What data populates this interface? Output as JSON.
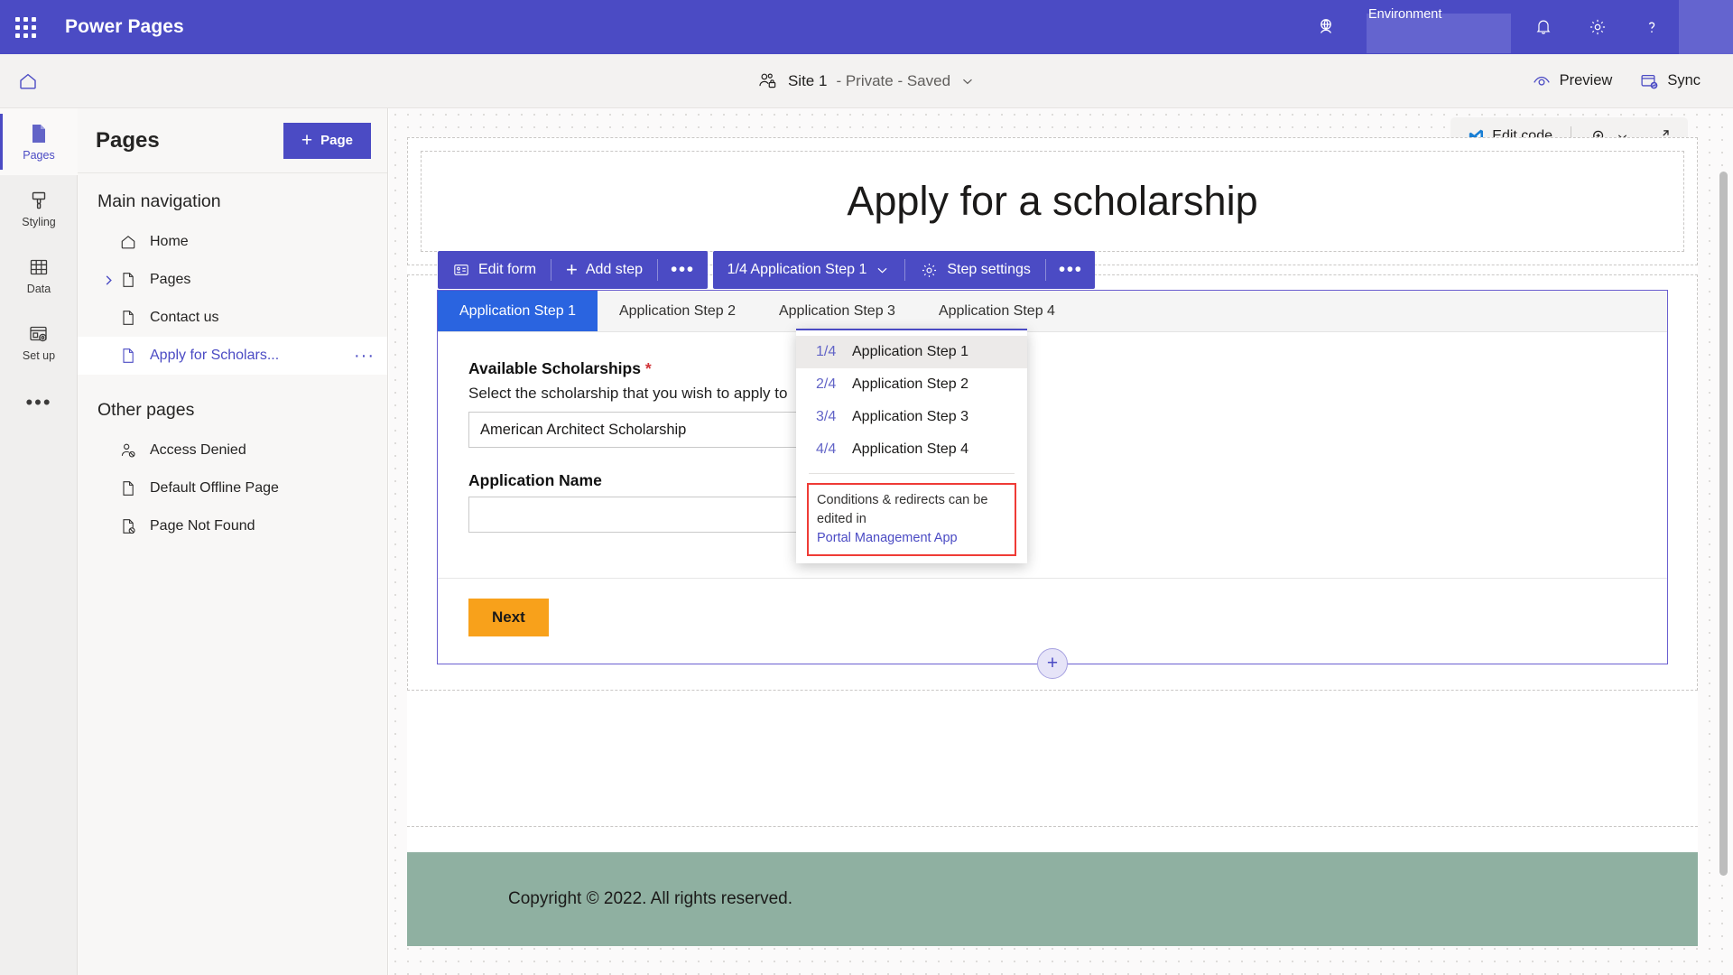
{
  "brandbar": {
    "app_title": "Power Pages",
    "waffle_label": "app-launcher",
    "environment_label": "Environment",
    "icons": {
      "globe": "globe-icon",
      "bell": "notifications-icon",
      "gear": "settings-icon",
      "help": "help-icon"
    }
  },
  "commandbar": {
    "home_label": "home-icon",
    "site_name": "Site 1",
    "site_meta": "- Private - Saved",
    "preview_label": "Preview",
    "sync_label": "Sync"
  },
  "rail": {
    "items": [
      {
        "label": "Pages",
        "icon": "page-icon",
        "active": true
      },
      {
        "label": "Styling",
        "icon": "brush-icon",
        "active": false
      },
      {
        "label": "Data",
        "icon": "table-icon",
        "active": false
      },
      {
        "label": "Set up",
        "icon": "setup-icon",
        "active": false
      }
    ],
    "more_label": "•••"
  },
  "panel": {
    "title": "Pages",
    "add_button": "Page",
    "main_nav_title": "Main navigation",
    "main_nav_items": [
      {
        "label": "Home",
        "icon": "home-icon",
        "expandable": false,
        "selected": false
      },
      {
        "label": "Pages",
        "icon": "file-icon",
        "expandable": true,
        "selected": false
      },
      {
        "label": "Contact us",
        "icon": "file-icon",
        "expandable": false,
        "selected": false
      },
      {
        "label": "Apply for Scholars...",
        "icon": "file-icon",
        "expandable": false,
        "selected": true
      }
    ],
    "other_pages_title": "Other pages",
    "other_pages_items": [
      {
        "label": "Access Denied",
        "icon": "access-denied-icon"
      },
      {
        "label": "Default Offline Page",
        "icon": "file-icon"
      },
      {
        "label": "Page Not Found",
        "icon": "page-not-found-icon"
      }
    ]
  },
  "canvas_toolbar": {
    "edit_code_label": "Edit code",
    "zoom_icon": "zoom-in-icon",
    "zoom_chevron": "chevron-down-icon",
    "expand_icon": "expand-icon"
  },
  "page": {
    "heading": "Apply for a scholarship",
    "footer_text": "Copyright © 2022. All rights reserved."
  },
  "form_toolbar": {
    "edit_form_label": "Edit form",
    "add_step_label": "Add step",
    "overflow_label": "•••",
    "step_selector_label": "1/4 Application Step 1",
    "step_settings_label": "Step settings",
    "overflow2_label": "•••"
  },
  "form_tabs": [
    {
      "label": "Application Step 1",
      "active": true
    },
    {
      "label": "Application Step 2",
      "active": false
    },
    {
      "label": "Application Step 3",
      "active": false
    },
    {
      "label": "Application Step 4",
      "active": false
    }
  ],
  "form_fields": {
    "scholarship": {
      "label": "Available Scholarships",
      "required_mark": "*",
      "help": "Select the scholarship that you wish to apply to",
      "value": "American Architect Scholarship"
    },
    "application_name": {
      "label": "Application Name",
      "value": ""
    },
    "next_label": "Next"
  },
  "step_menu": {
    "items": [
      {
        "frac": "1/4",
        "label": "Application Step 1",
        "highlighted": true
      },
      {
        "frac": "2/4",
        "label": "Application Step 2",
        "highlighted": false
      },
      {
        "frac": "3/4",
        "label": "Application Step 3",
        "highlighted": false
      },
      {
        "frac": "4/4",
        "label": "Application Step 4",
        "highlighted": false
      }
    ],
    "note_text": "Conditions & redirects can be edited in",
    "note_link": "Portal Management App"
  },
  "add_section": {
    "label": "+"
  },
  "colors": {
    "brand_purple": "#4b4bc4",
    "tab_blue": "#2a64e0",
    "next_orange": "#f8a11b",
    "footer_green": "#8fb0a1",
    "note_red": "#ef3b36"
  }
}
